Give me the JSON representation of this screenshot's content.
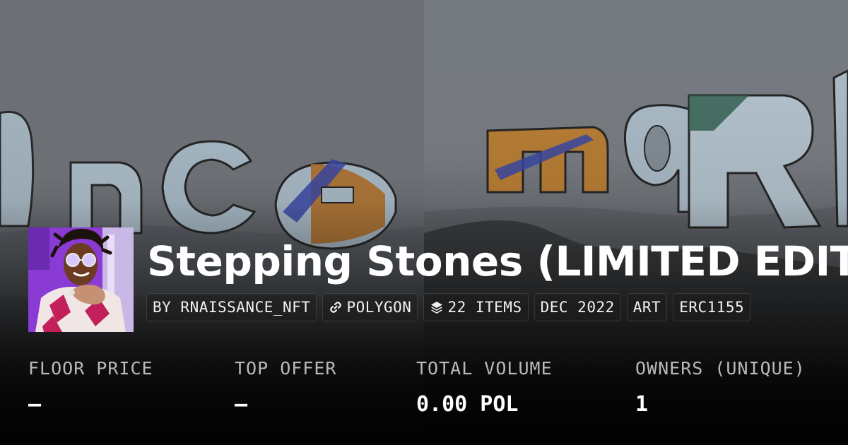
{
  "collection": {
    "title": "Stepping Stones (LIMITED EDITION)",
    "creator_chip": "BY RNAISSANCE_NFT",
    "chain_chip": "POLYGON",
    "items_chip": "22 ITEMS",
    "date_chip": "DEC 2022",
    "category_chip": "ART",
    "standard_chip": "ERC1155",
    "chain_icon": "link-icon",
    "items_icon": "layers-icon"
  },
  "stats": [
    {
      "label": "FLOOR PRICE",
      "value": "—"
    },
    {
      "label": "TOP OFFER",
      "value": "—"
    },
    {
      "label": "TOTAL VOLUME",
      "value": "0.00 POL"
    },
    {
      "label": "OWNERS (UNIQUE)",
      "value": "1"
    }
  ],
  "colors": {
    "text": "#ffffff",
    "label": "#b9b9b9",
    "chip_bg": "rgba(30,30,30,0.55)",
    "avatar_bg": "#8c3bd0"
  }
}
